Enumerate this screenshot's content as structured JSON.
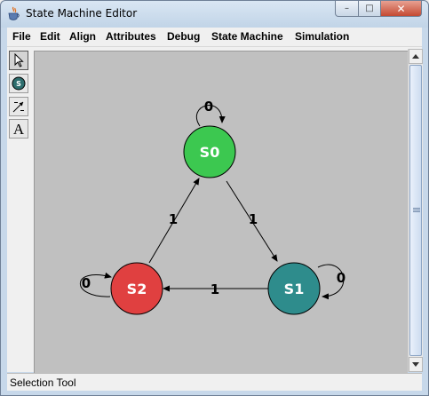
{
  "window": {
    "title": "State Machine Editor",
    "controls": {
      "minimize": "–",
      "maximize": "□",
      "close": "✕"
    }
  },
  "menu": [
    "File",
    "Edit",
    "Align",
    "Attributes",
    "Debug",
    "State Machine",
    "Simulation"
  ],
  "toolbar": {
    "tools": [
      {
        "name": "selection-tool",
        "icon": "arrow-pointer-icon",
        "selected": true
      },
      {
        "name": "state-tool",
        "icon": "state-circle-icon",
        "label": "S"
      },
      {
        "name": "transition-tool",
        "icon": "transition-arrow-icon"
      },
      {
        "name": "text-tool",
        "icon": "text-icon",
        "label": "A"
      }
    ]
  },
  "diagram": {
    "states": [
      {
        "id": "S0",
        "label": "S0",
        "color": "#3cc850"
      },
      {
        "id": "S1",
        "label": "S1",
        "color": "#2e8c8c"
      },
      {
        "id": "S2",
        "label": "S2",
        "color": "#e04040"
      }
    ],
    "transitions": [
      {
        "from": "S0",
        "to": "S0",
        "label": "0"
      },
      {
        "from": "S0",
        "to": "S1",
        "label": "1"
      },
      {
        "from": "S1",
        "to": "S1",
        "label": "0"
      },
      {
        "from": "S1",
        "to": "S2",
        "label": "1"
      },
      {
        "from": "S2",
        "to": "S2",
        "label": "0"
      },
      {
        "from": "S2",
        "to": "S0",
        "label": "1"
      }
    ]
  },
  "status": {
    "text": "Selection Tool"
  }
}
